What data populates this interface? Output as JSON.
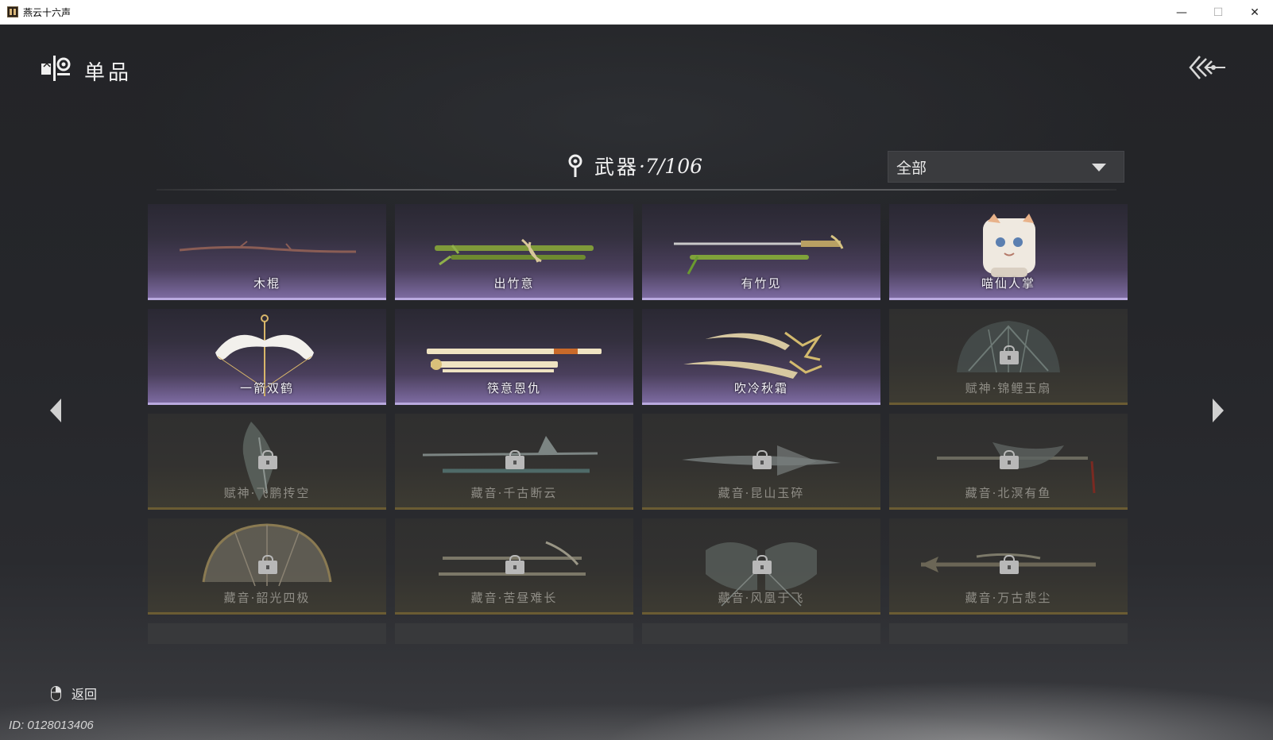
{
  "window": {
    "title": "燕云十六声",
    "min": "—",
    "max": "☐",
    "close": "✕"
  },
  "header": {
    "title": "单品"
  },
  "category": {
    "name": "武器",
    "count": "·7/106"
  },
  "filter": {
    "selected": "全部"
  },
  "items": [
    {
      "name": "木棍",
      "owned": true,
      "art": "staff"
    },
    {
      "name": "出竹意",
      "owned": true,
      "art": "bamboo"
    },
    {
      "name": "有竹见",
      "owned": true,
      "art": "sword-bamboo"
    },
    {
      "name": "喵仙人掌",
      "owned": true,
      "art": "cat-paw"
    },
    {
      "name": "一箭双鹤",
      "owned": true,
      "art": "bow"
    },
    {
      "name": "筷意恩仇",
      "owned": true,
      "art": "chopsticks"
    },
    {
      "name": "吹冷秋霜",
      "owned": true,
      "art": "twin-blades"
    },
    {
      "name": "赋神·锦鲤玉扇",
      "owned": false,
      "art": "fan"
    },
    {
      "name": "赋神·飞鹏抟空",
      "owned": false,
      "art": "wing"
    },
    {
      "name": "藏音·千古断云",
      "owned": false,
      "art": "spear"
    },
    {
      "name": "藏音·昆山玉碎",
      "owned": false,
      "art": "blade"
    },
    {
      "name": "藏音·北溟有鱼",
      "owned": false,
      "art": "spear-fish"
    },
    {
      "name": "藏音·韶光四极",
      "owned": false,
      "art": "fan-gold"
    },
    {
      "name": "藏音·苦昼难长",
      "owned": false,
      "art": "twin-spears"
    },
    {
      "name": "藏音·风凰于飞",
      "owned": false,
      "art": "bow-phoenix"
    },
    {
      "name": "藏音·万古悲尘",
      "owned": false,
      "art": "long-spear"
    }
  ],
  "footer": {
    "back_label": "返回",
    "user_id": "ID: 0128013406"
  },
  "colors": {
    "owned_accent": "#b9a9df",
    "locked_accent": "#6b5c33"
  }
}
